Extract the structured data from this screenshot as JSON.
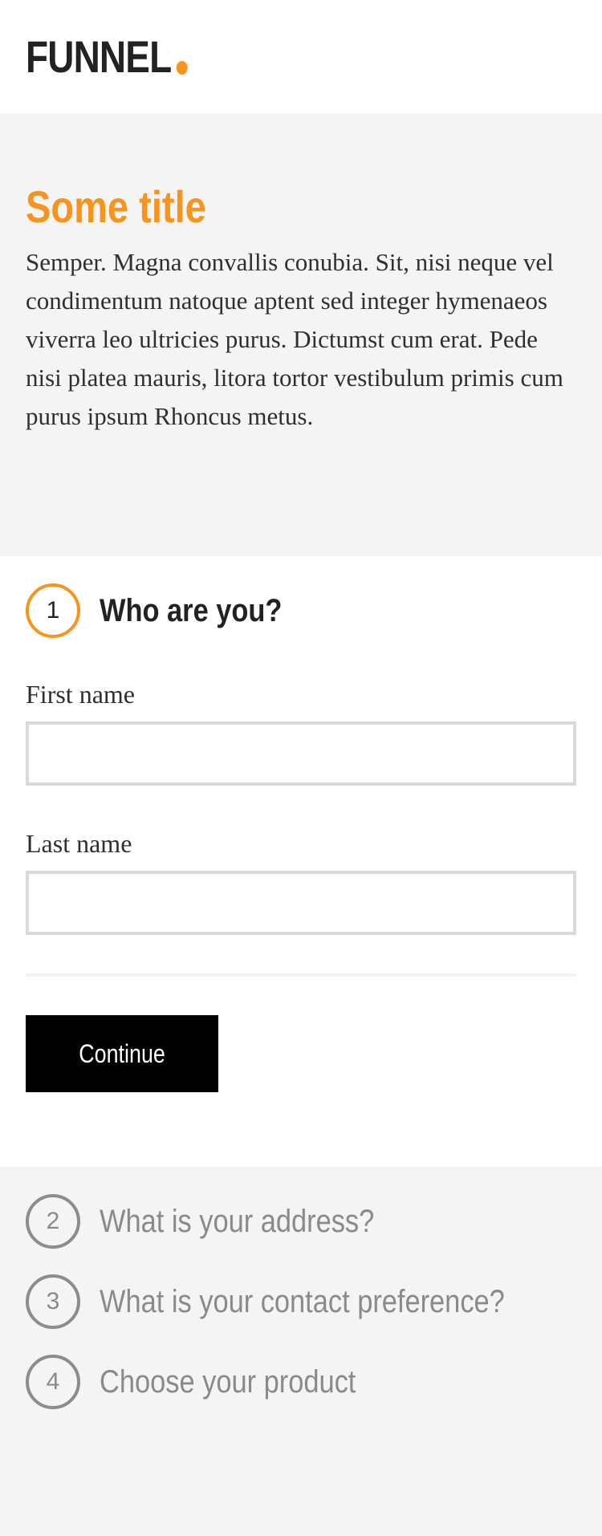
{
  "header": {
    "logo_text": "FUNNEL",
    "logo_dot_color": "#f7941d"
  },
  "intro": {
    "title": "Some title",
    "text": "Semper. Magna convallis conubia. Sit, nisi neque vel condimentum natoque aptent sed integer hymenaeos viverra leo ultricies purus. Dictumst cum erat. Pede nisi platea mauris, litora tortor vestibulum primis cum purus ipsum Rhoncus metus."
  },
  "active_step": {
    "number": "1",
    "title": "Who are you?",
    "fields": [
      {
        "label": "First name",
        "value": ""
      },
      {
        "label": "Last name",
        "value": ""
      }
    ],
    "continue_label": "Continue"
  },
  "pending_steps": [
    {
      "number": "2",
      "title": "What is your address?"
    },
    {
      "number": "3",
      "title": "What is your contact preference?"
    },
    {
      "number": "4",
      "title": "Choose your product"
    }
  ],
  "colors": {
    "accent": "#f7941d",
    "button_bg": "#000000",
    "muted": "#8a8a8a",
    "section_bg": "#f4f4f4"
  }
}
